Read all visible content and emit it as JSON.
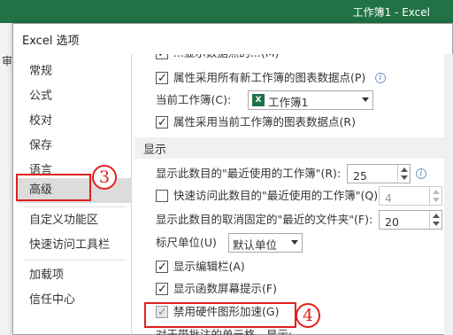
{
  "excel": {
    "window_title": "工作簿1 - Excel",
    "ribbon_tab": "审"
  },
  "dialog": {
    "title": "Excel 选项"
  },
  "sidebar": {
    "items": [
      {
        "label": "常规"
      },
      {
        "label": "公式"
      },
      {
        "label": "校对"
      },
      {
        "label": "保存"
      },
      {
        "label": "语言"
      },
      {
        "label": "高级",
        "selected": true
      },
      {
        "label": "自定义功能区"
      },
      {
        "label": "快速访问工具栏"
      },
      {
        "label": "加载项"
      },
      {
        "label": "信任中心"
      }
    ]
  },
  "annotations": {
    "step3": "3",
    "step4": "4",
    "accent_color": "#e02020"
  },
  "content": {
    "cut_row": "...显示数据点的...(M)",
    "row_all_books": "属性采用所有新工作簿的图表数据点(P)",
    "current_book_label": "当前工作簿(C):",
    "current_book_value": "工作簿1",
    "row_current_book": "属性采用当前工作簿的图表数据点(R)",
    "section_display": "显示",
    "recent_books_label": "显示此数目的\"最近使用的工作簿\"(R):",
    "recent_books_value": "25",
    "quick_access_label": "快速访问此数目的\"最近使用的工作簿\"(Q):",
    "quick_access_value": "4",
    "unpinned_folders_label": "显示此数目的取消固定的\"最近的文件夹\"(F):",
    "unpinned_folders_value": "20",
    "ruler_units_label": "标尺单位(U)",
    "ruler_units_value": "默认单位",
    "show_formula_bar": "显示编辑栏(A)",
    "show_function_tips": "显示函数屏幕提示(F)",
    "disable_hw_accel": "禁用硬件图形加速(G)",
    "cut_bottom_row": "对于带批注的单元格，显示:"
  }
}
